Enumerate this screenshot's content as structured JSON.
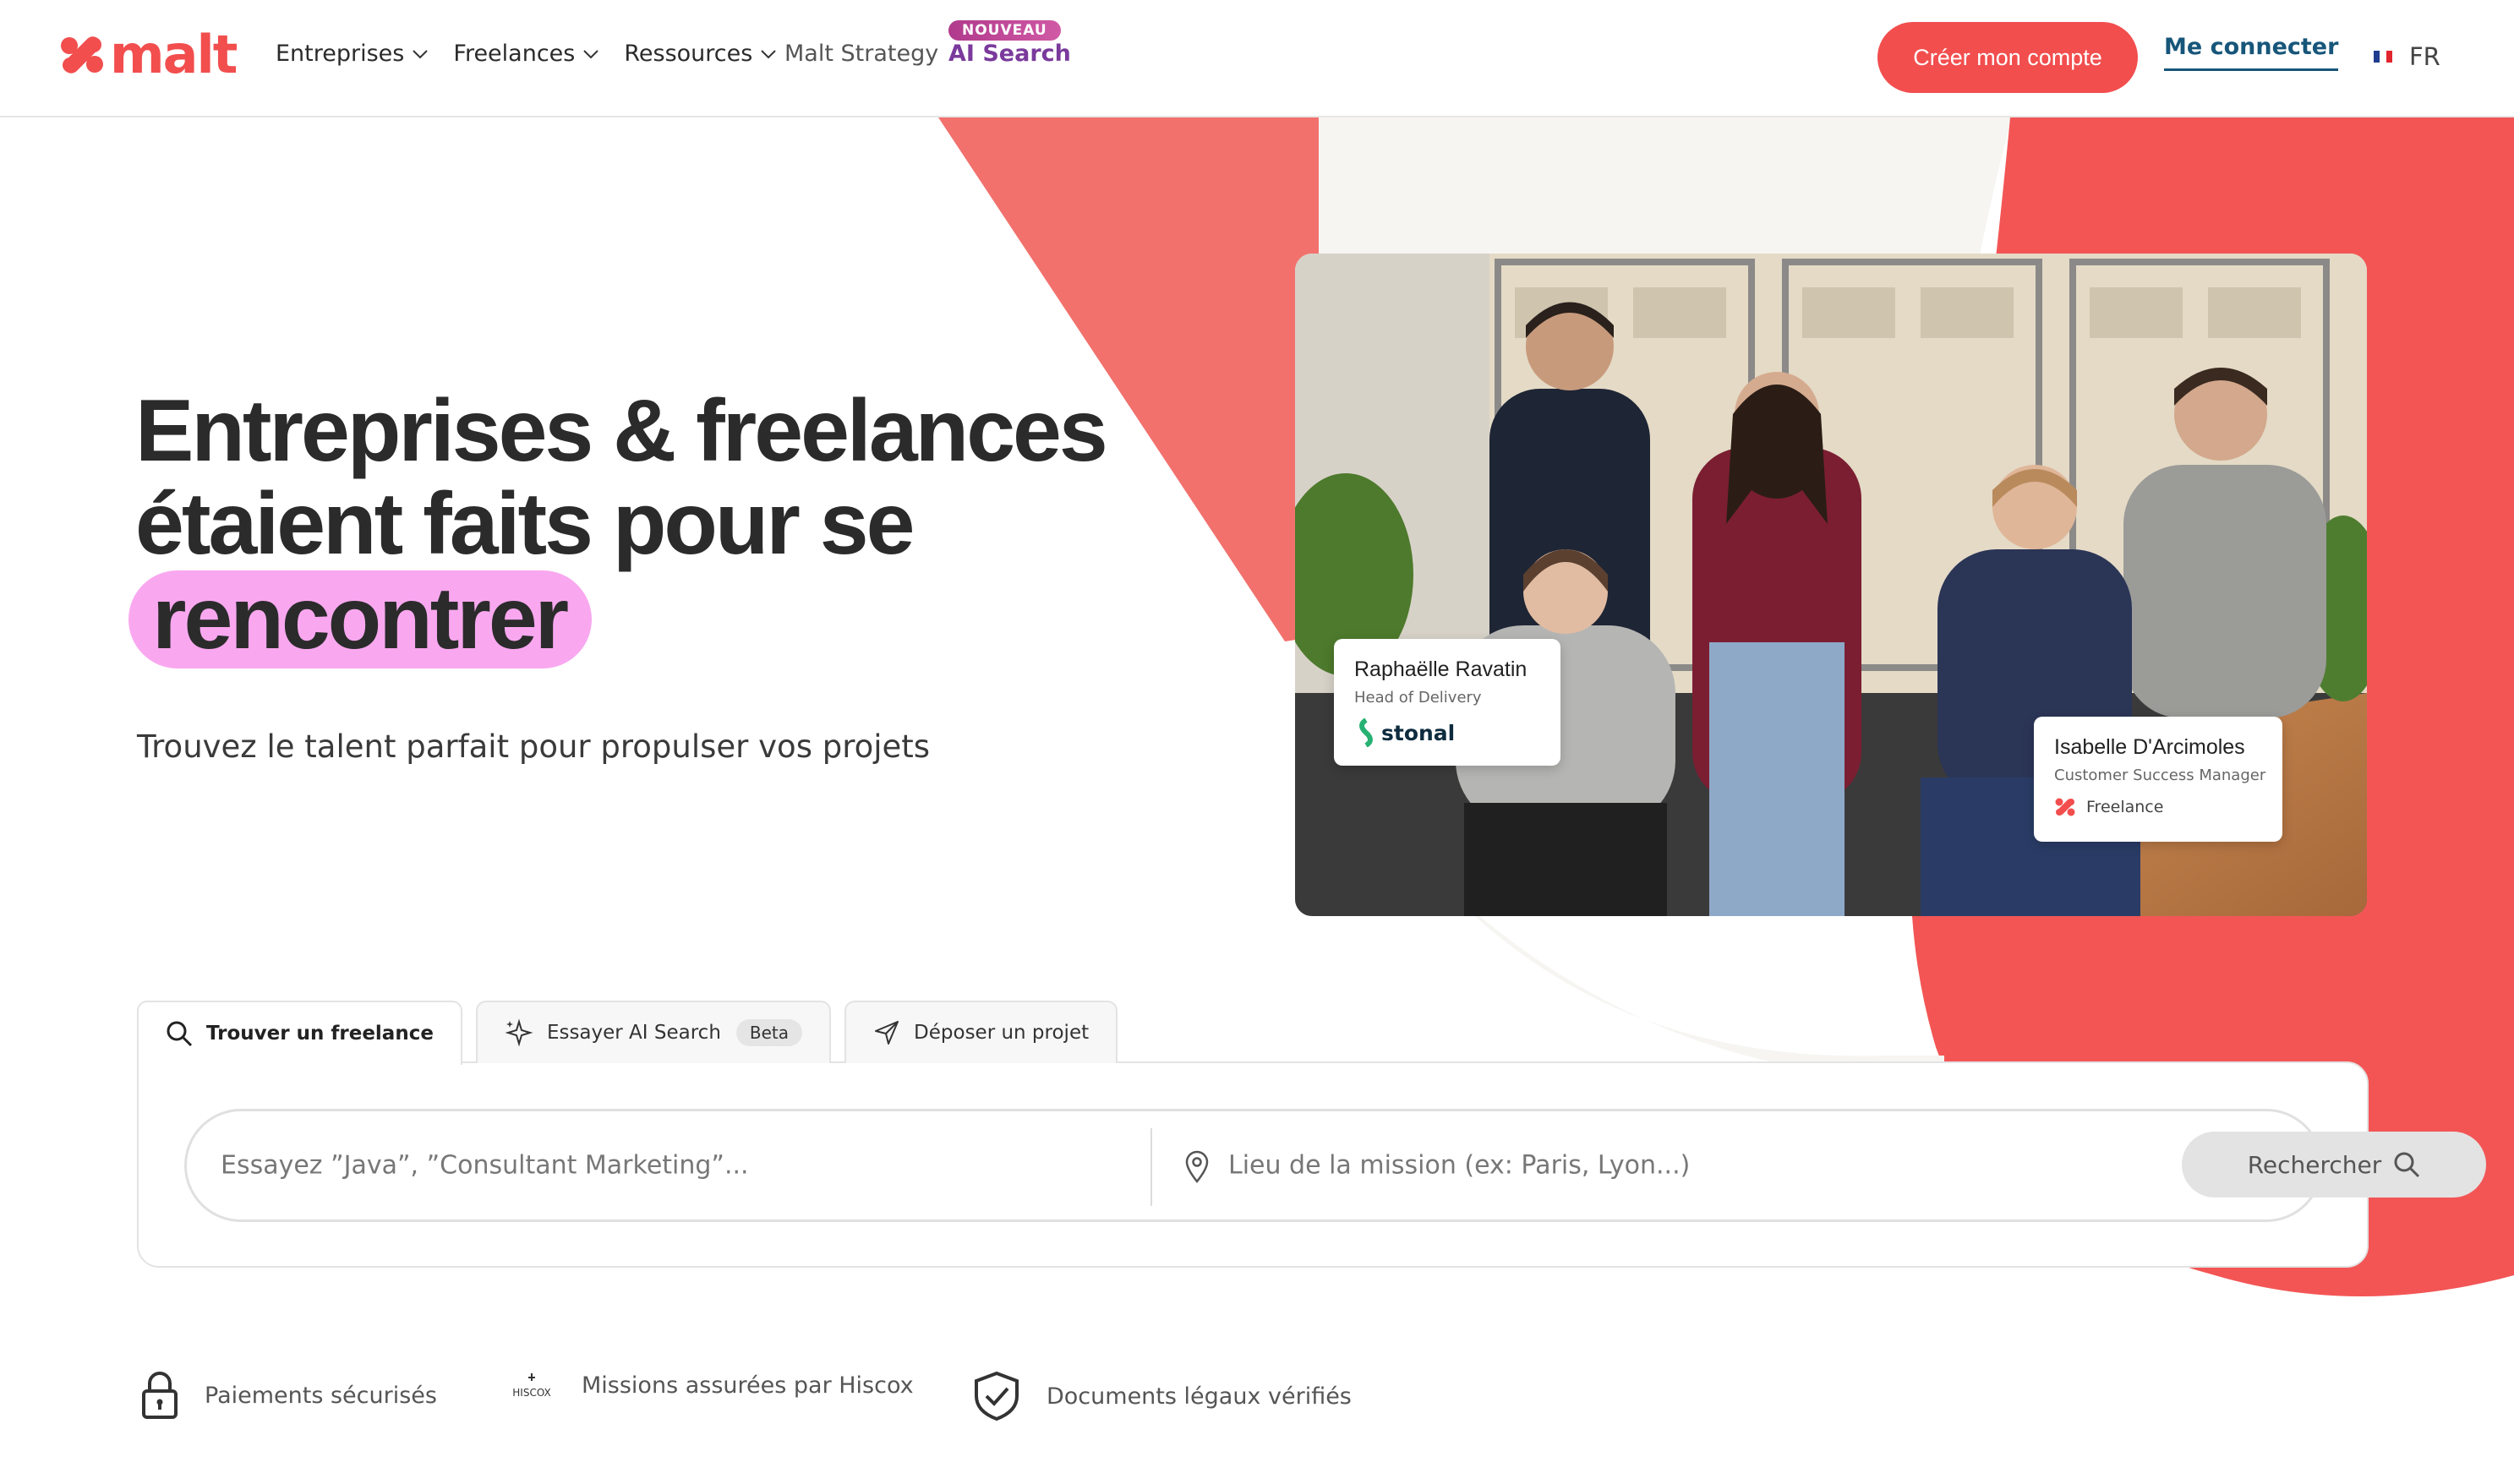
{
  "brand": {
    "name": "malt",
    "accent": "#f24e4e",
    "highlight": "#f9a8f0",
    "link": "#17567a"
  },
  "nav": {
    "items": [
      {
        "label": "Entreprises",
        "icon": "chevron-down-icon"
      },
      {
        "label": "Freelances",
        "icon": "chevron-down-icon"
      },
      {
        "label": "Ressources",
        "icon": "chevron-down-icon"
      }
    ],
    "strategy": "Malt Strategy",
    "ai_badge": "NOUVEAU",
    "ai_search": "AI Search"
  },
  "header": {
    "create_account": "Créer mon compte",
    "login": "Me connecter",
    "lang": "FR"
  },
  "hero": {
    "title_line1": "Entreprises & freelances",
    "title_line2": "étaient faits pour se",
    "title_highlight": "rencontrer",
    "subtitle": "Trouvez le talent parfait pour propulser vos projets"
  },
  "cards": [
    {
      "name": "Raphaëlle Ravatin",
      "role": "Head of Delivery",
      "company": "stonal"
    },
    {
      "name": "Isabelle D'Arcimoles",
      "role": "Customer Success Manager",
      "company": "Freelance"
    }
  ],
  "tabs": [
    {
      "label": "Trouver un freelance",
      "icon": "search-icon",
      "active": true
    },
    {
      "label": "Essayer AI Search",
      "icon": "sparkle-icon",
      "badge": "Beta"
    },
    {
      "label": "Déposer un projet",
      "icon": "send-icon"
    }
  ],
  "search": {
    "query_placeholder": "Essayez ”Java”, ”Consultant Marketing”...",
    "location_placeholder": "Lieu de la mission (ex: Paris, Lyon...)",
    "button": "Rechercher"
  },
  "trust": [
    {
      "label": "Paiements sécurisés",
      "icon": "lock-icon"
    },
    {
      "label": "Missions assurées par Hiscox",
      "icon": "hiscox-logo",
      "logo_text": "HISCOX"
    },
    {
      "label": "Documents légaux vérifiés",
      "icon": "shield-check-icon"
    }
  ]
}
